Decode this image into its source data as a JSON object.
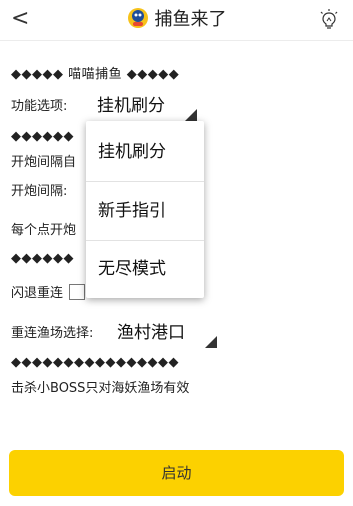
{
  "header": {
    "back_label": "<",
    "title": "捕鱼来了"
  },
  "settings": {
    "section1_title": "◆◆◆◆◆ 喵喵捕鱼 ◆◆◆◆◆",
    "function_label": "功能选项:",
    "function_value": "挂机刷分",
    "section2_title": "◆◆◆◆◆◆",
    "fire_interval_auto_label": "开炮间隔自",
    "fire_interval_label": "开炮间隔:",
    "per_point_label": "每个点开炮",
    "section3_title": "◆◆◆◆◆◆",
    "reconnect_label": "闪退重连",
    "reconnect_field_label": "重连渔场选择:",
    "reconnect_field_value": "渔村港口",
    "section4_title": "◆◆◆◆◆◆◆◆◆◆◆◆◆◆◆◆",
    "note_text": "击杀小BOSS只对海妖渔场有效"
  },
  "dropdown": {
    "options": [
      "挂机刷分",
      "新手指引",
      "无尽模式"
    ]
  },
  "footer": {
    "start_label": "启动"
  },
  "colors": {
    "accent": "#fcd100"
  },
  "icons": {
    "app": "fishing-app-icon",
    "bulb": "lightbulb-icon"
  }
}
